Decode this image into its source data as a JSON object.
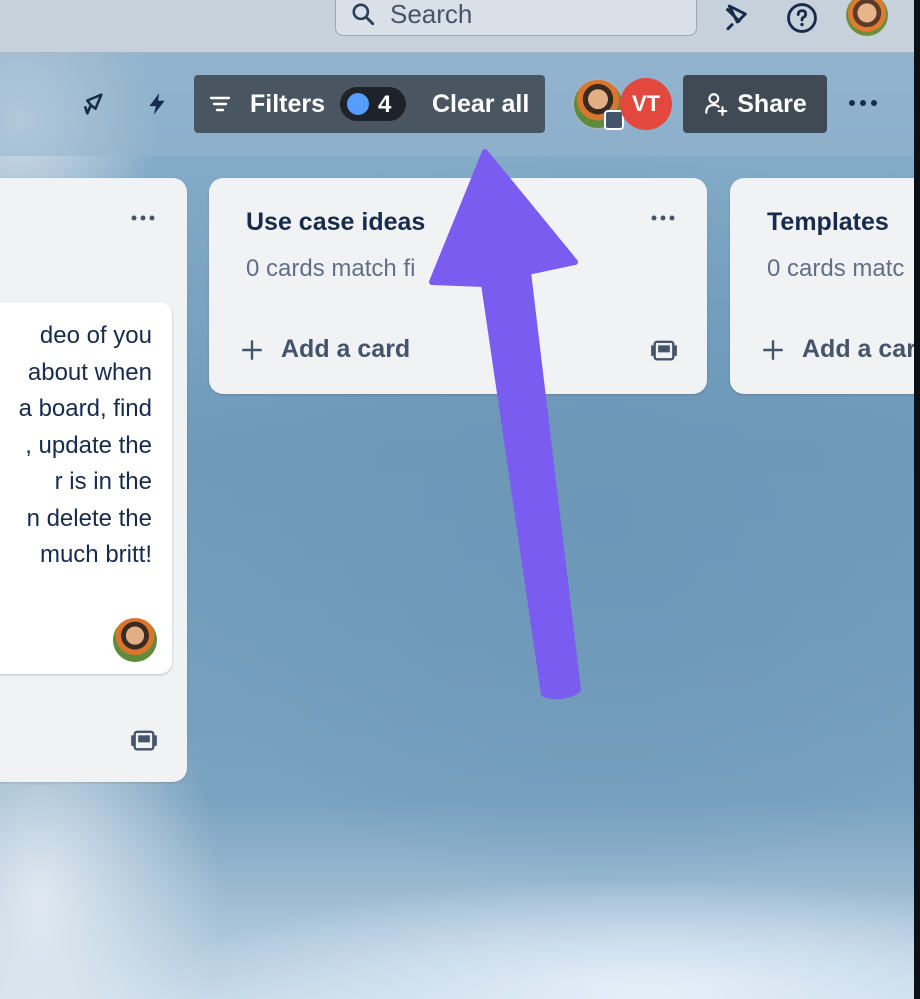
{
  "topbar": {
    "search_placeholder": "Search",
    "icons": [
      "search-icon",
      "megaphone-icon",
      "help-icon",
      "avatar"
    ]
  },
  "board_header": {
    "filters_label": "Filters",
    "filter_count": "4",
    "clear_all_label": "Clear all",
    "member_initials": "VT",
    "share_label": "Share",
    "accent_colors": {
      "filter_dot": "#579dff",
      "member_vt": "#e2483d",
      "arrow": "#7b5cf0"
    }
  },
  "lists": [
    {
      "title": "",
      "card_text_lines": [
        "deo of you",
        "about when",
        "a board, find",
        ", update the",
        "r is in the",
        "n delete the",
        "much britt!"
      ]
    },
    {
      "title": "Use case ideas",
      "subtitle": "0 cards match fi",
      "add_card_label": "Add a card"
    },
    {
      "title": "Templates",
      "subtitle": "0 cards matc",
      "add_card_label": "Add a car"
    }
  ]
}
